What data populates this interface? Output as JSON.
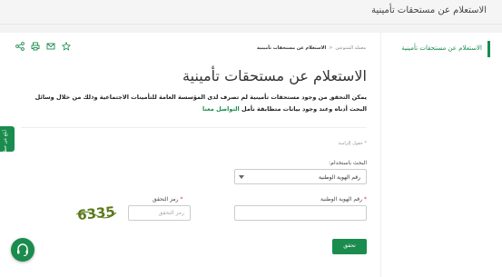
{
  "header": {
    "title": "الاستعلام عن مستحقات تأمينية"
  },
  "side_menu": {
    "active_item": "الاستعلام عن مستحقات تأمينية"
  },
  "breadcrumb": {
    "parent": "معمله المتنوعين",
    "separator": "<",
    "current": "الاستعلام عن مستحقات تأمينية"
  },
  "action_icons": [
    "share-icon",
    "print-icon",
    "mail-icon",
    "star-icon"
  ],
  "page": {
    "title": "الاستعلام عن مستحقات تأمينية",
    "intro_text": "يمكن التحقق من وجود مستحقات تأمينية لم تصرف لدى المؤسسة العامة للتأمينات الاجتماعية وذلك من خلال وسائل البحث أدناه وعند وجود بيانات متطابقة",
    "intro_prefix": "نأمل",
    "intro_link": "التواصل معنا"
  },
  "form": {
    "required_note": "* حقول إلزامية",
    "search_by_label": "البحث باستخدام:",
    "search_by_value": "رقم الهوية الوطنية",
    "national_id_label": "رقم الهوية الوطنية",
    "national_id_value": "",
    "national_id_placeholder": "",
    "captcha_label": "رمز التحقق",
    "captcha_placeholder": "رمز التحقق",
    "captcha_image_text": "6335",
    "required_mark": "*",
    "submit_label": "تحقق"
  },
  "feedback_tab": {
    "label": "أبلغ عن خطأ"
  },
  "colors": {
    "accent": "#1a8c4e",
    "required": "#d33333",
    "background": "#f3f3f3"
  }
}
